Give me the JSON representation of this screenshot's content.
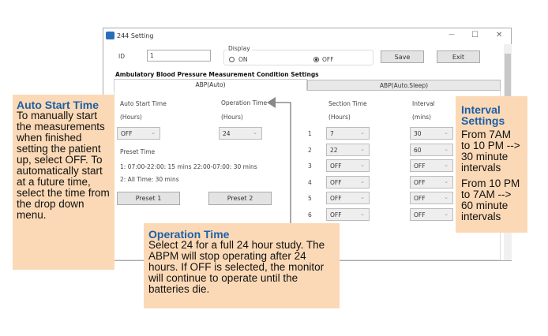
{
  "window": {
    "title": "244 Setting",
    "minimize": "—",
    "maximize": "☐",
    "close": "✕"
  },
  "id_label": "ID",
  "id_value": "1",
  "display": {
    "label": "Display",
    "on": "ON",
    "off": "OFF",
    "selected": "OFF"
  },
  "save": "Save",
  "exit": "Exit",
  "section_title": "Ambulatory Blood Pressure Measurement Condition Settings",
  "tabs": [
    {
      "label": "ABP(Auto)",
      "active": true
    },
    {
      "label": "ABP(Auto.Sleep)",
      "active": false
    }
  ],
  "auto_start": {
    "label": "Auto Start Time",
    "unit": "(Hours)",
    "value": "OFF"
  },
  "operation": {
    "label": "Operation Time",
    "unit": "(Hours)",
    "value": "24"
  },
  "preset": {
    "label": "Preset Time",
    "line1": "1: 07:00-22:00: 15 mins 22:00-07:00: 30 mins",
    "line2": "2: All Time: 30 mins",
    "btn1": "Preset 1",
    "btn2": "Preset 2"
  },
  "section": {
    "label": "Section Time",
    "unit": "(Hours)"
  },
  "interval": {
    "label": "Interval",
    "unit": "(mins)"
  },
  "rows": [
    {
      "n": "1",
      "section": "7",
      "interval": "30"
    },
    {
      "n": "2",
      "section": "22",
      "interval": "60"
    },
    {
      "n": "3",
      "section": "OFF",
      "interval": "OFF"
    },
    {
      "n": "4",
      "section": "OFF",
      "interval": "OFF"
    },
    {
      "n": "5",
      "section": "OFF",
      "interval": "OFF"
    },
    {
      "n": "6",
      "section": "OFF",
      "interval": "OFF"
    }
  ],
  "callouts": {
    "auto": {
      "title": "Auto Start Time",
      "body": "To manually start the measurements when finished setting the patient up, select OFF.  To automatically start at a future time, select the time from the drop down menu."
    },
    "op": {
      "title": "Operation Time",
      "body": "Select 24 for a full 24 hour study. The ABPM will stop operating after 24 hours.  If OFF is selected, the monitor will continue to operate until the batteries die."
    },
    "interval": {
      "title": "Interval Settings",
      "body1": "From 7AM to 10 PM --> 30 minute intervals",
      "body2": "From 10 PM to 7AM --> 60 minute intervals"
    }
  }
}
